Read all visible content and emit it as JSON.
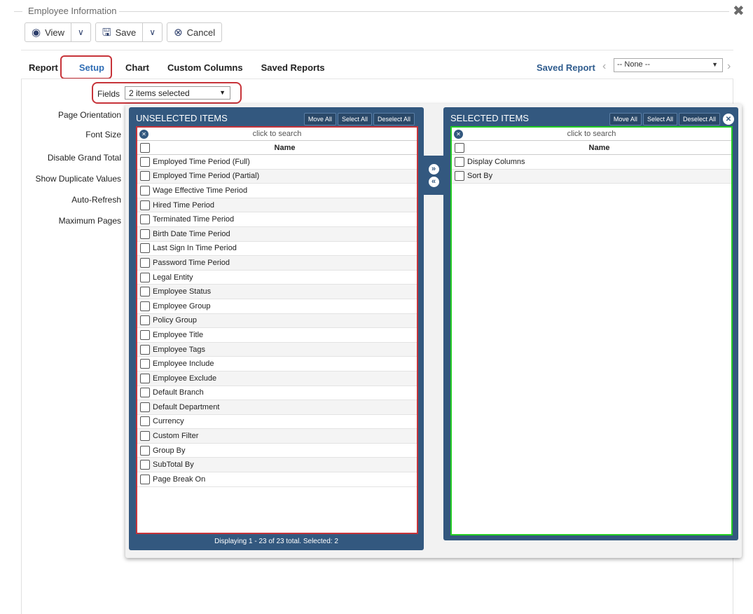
{
  "panel": {
    "title": "Employee Information"
  },
  "toolbar": {
    "view_label": "View",
    "save_label": "Save",
    "cancel_label": "Cancel"
  },
  "tabs": [
    {
      "label": "Report"
    },
    {
      "label": "Setup",
      "active": true
    },
    {
      "label": "Chart"
    },
    {
      "label": "Custom Columns"
    },
    {
      "label": "Saved Reports"
    }
  ],
  "saved_report": {
    "label": "Saved Report",
    "value": "-- None --"
  },
  "fields": {
    "label": "Fields",
    "value": "2 items selected"
  },
  "settings": {
    "page_orientation": "Page Orientation",
    "font_size": "Font Size",
    "disable_grand_total": "Disable Grand Total",
    "show_duplicate_values": "Show Duplicate Values",
    "auto_refresh": "Auto-Refresh",
    "maximum_pages": "Maximum Pages"
  },
  "unselected": {
    "header": "UNSELECTED ITEMS",
    "move_all": "Move All",
    "select_all": "Select All",
    "deselect_all": "Deselect All",
    "search_placeholder": "click to search",
    "column": "Name",
    "items": [
      "Employed Time Period (Full)",
      "Employed Time Period (Partial)",
      "Wage Effective Time Period",
      "Hired Time Period",
      "Terminated Time Period",
      "Birth Date Time Period",
      "Last Sign In Time Period",
      "Password Time Period",
      "Legal Entity",
      "Employee Status",
      "Employee Group",
      "Policy Group",
      "Employee Title",
      "Employee Tags",
      "Employee Include",
      "Employee Exclude",
      "Default Branch",
      "Default Department",
      "Currency",
      "Custom Filter",
      "Group By",
      "SubTotal By",
      "Page Break On"
    ],
    "footer": "Displaying 1 - 23 of 23 total. Selected: 2"
  },
  "selected": {
    "header": "SELECTED ITEMS",
    "move_all": "Move All",
    "select_all": "Select All",
    "deselect_all": "Deselect All",
    "search_placeholder": "click to search",
    "column": "Name",
    "items": [
      "Display Columns",
      "Sort By"
    ]
  },
  "colors": {
    "accent": "#2f6db5",
    "panel_header": "#33587f",
    "highlight_red": "#c7343a",
    "highlight_green": "#22cc22"
  }
}
